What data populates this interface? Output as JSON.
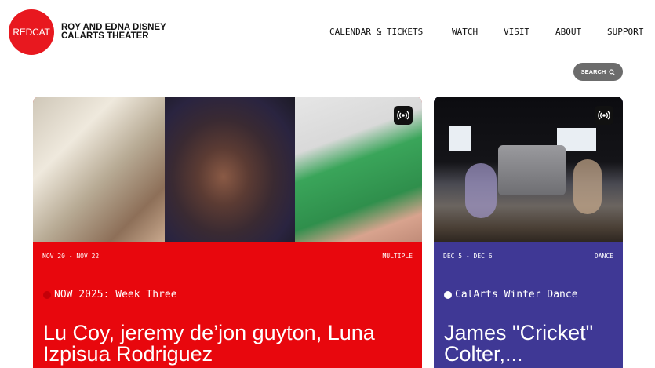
{
  "brand": {
    "logo_text": "REDCAT",
    "line1": "ROY AND EDNA DISNEY",
    "line2": "CALARTS THEATER"
  },
  "nav": {
    "items": [
      "CALENDAR & TICKETS",
      "WATCH",
      "VISIT",
      "ABOUT",
      "SUPPORT"
    ]
  },
  "search": {
    "label": "SEARCH",
    "icon": "search-icon"
  },
  "cards": [
    {
      "dates": "NOV 20 - NOV 22",
      "category": "MULTIPLE",
      "series": "NOW 2025: Week Three",
      "series_dot_color": "#c40008",
      "title": "Lu Coy, jeremy de’jon guyton, Luna Izpisua Rodriguez",
      "background": "#e8070d",
      "icon": "live-stream-icon"
    },
    {
      "dates": "DEC 5 - DEC 6",
      "category": "DANCE",
      "series": "CalArts Winter Dance",
      "series_dot_color": "#ffffff",
      "title": "James \"Cricket\" Colter,...",
      "background": "#3f3895",
      "icon": "live-stream-icon"
    }
  ]
}
